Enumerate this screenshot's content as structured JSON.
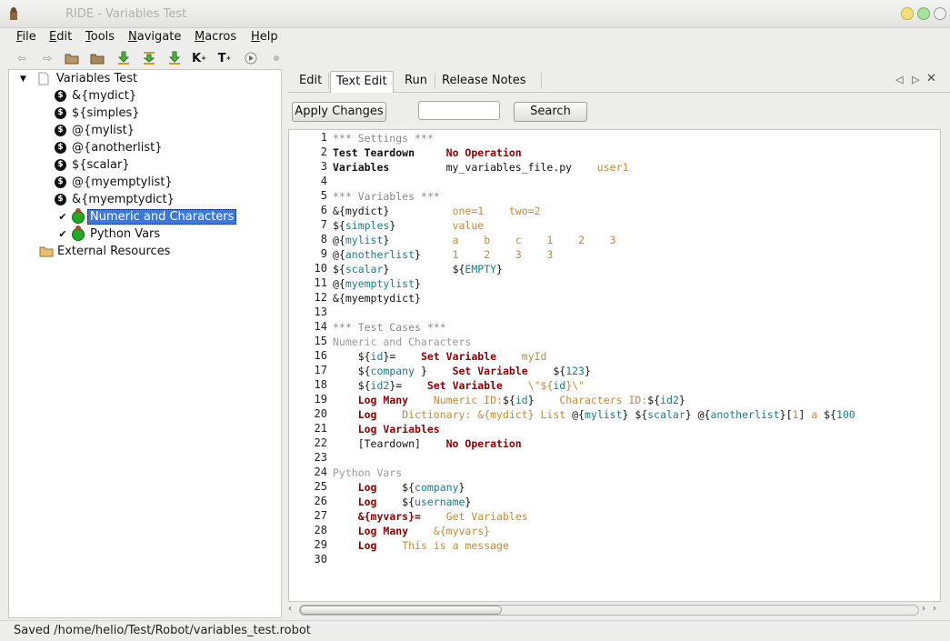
{
  "window": {
    "title": "RIDE - Variables Test"
  },
  "menubar": {
    "items": [
      "File",
      "Edit",
      "Tools",
      "Navigate",
      "Macros",
      "Help"
    ]
  },
  "toolbar": {
    "k_label": "K",
    "t_label": "T"
  },
  "tree": {
    "root": "Variables Test",
    "vars": [
      "&{mydict}",
      "${simples}",
      "@{mylist}",
      "@{anotherlist}",
      "${scalar}",
      "@{myemptylist}",
      "&{myemptydict}"
    ],
    "tests": [
      "Numeric and Characters",
      "Python Vars"
    ],
    "external": "External Resources"
  },
  "tabs": {
    "edit": "Edit",
    "text_edit": "Text Edit",
    "run": "Run",
    "release_notes": "Release Notes"
  },
  "actions": {
    "apply": "Apply Changes",
    "search": "Search",
    "search_value": ""
  },
  "status": {
    "text": "Saved /home/helio/Test/Robot/variables_test.robot"
  },
  "editor": {
    "line_numbers": [
      "1",
      "2",
      "3",
      "4",
      "5",
      "6",
      "7",
      "8",
      "9",
      "10",
      "11",
      "12",
      "13",
      "14",
      "15",
      "16",
      "17",
      "18",
      "19",
      "20",
      "21",
      "22",
      "23",
      "24",
      "25",
      "26",
      "27",
      "28",
      "29",
      "30"
    ],
    "lines": [
      [
        [
          "hdr",
          "*** Settings ***"
        ]
      ],
      [
        [
          "def",
          "Test Teardown"
        ],
        [
          "plain",
          "     "
        ],
        [
          "kw",
          "No Operation"
        ]
      ],
      [
        [
          "def",
          "Variables"
        ],
        [
          "plain",
          "         my_variables_file.py    "
        ],
        [
          "arg",
          "user1"
        ]
      ],
      [],
      [
        [
          "hdr",
          "*** Variables ***"
        ]
      ],
      [
        [
          "plain",
          "&{mydict}          "
        ],
        [
          "arg",
          "one=1    two=2"
        ]
      ],
      [
        [
          "plain",
          "${"
        ],
        [
          "var",
          "simples"
        ],
        [
          "plain",
          "}         "
        ],
        [
          "arg",
          "value"
        ]
      ],
      [
        [
          "plain",
          "@{"
        ],
        [
          "var",
          "mylist"
        ],
        [
          "plain",
          "}          "
        ],
        [
          "arg",
          "a    b    c    1    2    3"
        ]
      ],
      [
        [
          "plain",
          "@{"
        ],
        [
          "var",
          "anotherlist"
        ],
        [
          "plain",
          "}     "
        ],
        [
          "arg",
          "1    2    3    3"
        ]
      ],
      [
        [
          "plain",
          "${"
        ],
        [
          "var",
          "scalar"
        ],
        [
          "plain",
          "}          ${"
        ],
        [
          "var",
          "EMPTY"
        ],
        [
          "plain",
          "}"
        ]
      ],
      [
        [
          "plain",
          "@{"
        ],
        [
          "var",
          "myemptylist"
        ],
        [
          "plain",
          "}"
        ]
      ],
      [
        [
          "plain",
          "&{myemptydict}"
        ]
      ],
      [],
      [
        [
          "hdr",
          "*** Test Cases ***"
        ]
      ],
      [
        [
          "tc",
          "Numeric and Characters"
        ]
      ],
      [
        [
          "plain",
          "    ${"
        ],
        [
          "var",
          "id"
        ],
        [
          "plain",
          "}=    "
        ],
        [
          "kw",
          "Set Variable"
        ],
        [
          "plain",
          "    "
        ],
        [
          "arg",
          "myId"
        ]
      ],
      [
        [
          "plain",
          "    ${"
        ],
        [
          "var",
          "company"
        ],
        [
          "plain",
          " }    "
        ],
        [
          "kw",
          "Set Variable"
        ],
        [
          "plain",
          "    ${"
        ],
        [
          "var",
          "123"
        ],
        [
          "plain",
          "}"
        ]
      ],
      [
        [
          "plain",
          "    ${"
        ],
        [
          "var",
          "id2"
        ],
        [
          "plain",
          "}=    "
        ],
        [
          "kw",
          "Set Variable"
        ],
        [
          "plain",
          "    "
        ],
        [
          "arg",
          "\\\"${"
        ],
        [
          "var",
          "id"
        ],
        [
          "arg",
          "}\\\""
        ]
      ],
      [
        [
          "plain",
          "    "
        ],
        [
          "kw",
          "Log Many"
        ],
        [
          "plain",
          "    "
        ],
        [
          "arg",
          "Numeric ID:"
        ],
        [
          "plain",
          "${"
        ],
        [
          "var",
          "id"
        ],
        [
          "plain",
          "}    "
        ],
        [
          "arg",
          "Characters ID:"
        ],
        [
          "plain",
          "${"
        ],
        [
          "var",
          "id2"
        ],
        [
          "plain",
          "}"
        ]
      ],
      [
        [
          "plain",
          "    "
        ],
        [
          "kw",
          "Log"
        ],
        [
          "plain",
          "    "
        ],
        [
          "arg",
          "Dictionary: &{mydict} List "
        ],
        [
          "plain",
          "@{"
        ],
        [
          "var",
          "mylist"
        ],
        [
          "plain",
          "} ${"
        ],
        [
          "var",
          "scalar"
        ],
        [
          "plain",
          "} @{"
        ],
        [
          "var",
          "anotherlist"
        ],
        [
          "plain",
          "}["
        ],
        [
          "arg",
          "1"
        ],
        [
          "plain",
          "] "
        ],
        [
          "arg",
          "a"
        ],
        [
          "plain",
          " ${"
        ],
        [
          "var",
          "100"
        ]
      ],
      [
        [
          "plain",
          "    "
        ],
        [
          "kw",
          "Log Variables"
        ]
      ],
      [
        [
          "plain",
          "    [Teardown]    "
        ],
        [
          "kw",
          "No Operation"
        ]
      ],
      [],
      [
        [
          "tc",
          "Python Vars"
        ]
      ],
      [
        [
          "plain",
          "    "
        ],
        [
          "kw",
          "Log"
        ],
        [
          "plain",
          "    ${"
        ],
        [
          "var",
          "company"
        ],
        [
          "plain",
          "}"
        ]
      ],
      [
        [
          "plain",
          "    "
        ],
        [
          "kw",
          "Log"
        ],
        [
          "plain",
          "    ${"
        ],
        [
          "var",
          "username"
        ],
        [
          "plain",
          "}"
        ]
      ],
      [
        [
          "plain",
          "    "
        ],
        [
          "kw",
          "&{myvars}="
        ],
        [
          "plain",
          "    "
        ],
        [
          "arg",
          "Get Variables"
        ]
      ],
      [
        [
          "plain",
          "    "
        ],
        [
          "kw",
          "Log Many"
        ],
        [
          "plain",
          "    "
        ],
        [
          "arg",
          "&{myvars}"
        ]
      ],
      [
        [
          "plain",
          "    "
        ],
        [
          "kw",
          "Log"
        ],
        [
          "plain",
          "    "
        ],
        [
          "arg",
          "This is a message"
        ]
      ],
      []
    ]
  },
  "colors": {
    "selection": "#3b78d8",
    "keyword": "#8b0000",
    "variable": "#1b7a8a",
    "argument": "#c28a3a"
  }
}
